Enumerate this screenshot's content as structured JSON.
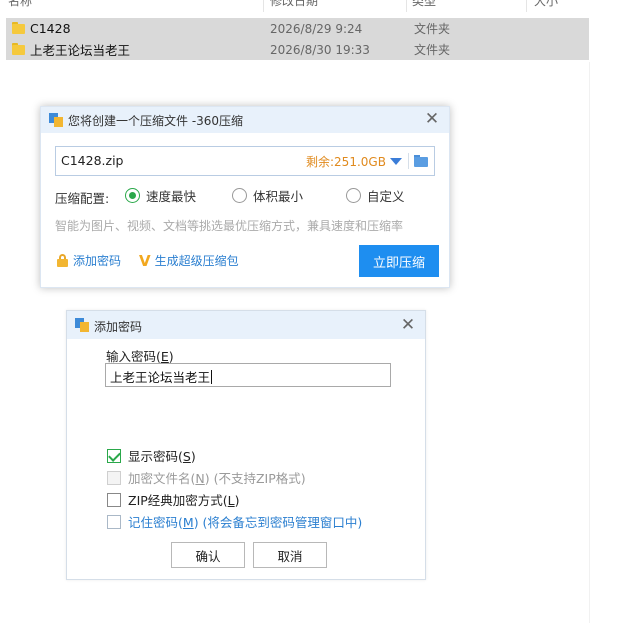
{
  "explorer": {
    "columns": [
      "名称",
      "修改日期",
      "类型",
      "大小"
    ],
    "rows": [
      {
        "name": "C1428",
        "date": "2026/8/29 9:24",
        "type": "文件夹"
      },
      {
        "name": "上老王论坛当老王",
        "date": "2026/8/30 19:33",
        "type": "文件夹"
      }
    ]
  },
  "compress_dialog": {
    "title": "您将创建一个压缩文件 -360压缩",
    "file_name": "C1428.zip",
    "free_space": "剩余:251.0GB",
    "config_label": "压缩配置:",
    "options": [
      "速度最快",
      "体积最小",
      "自定义"
    ],
    "selected_option": "速度最快",
    "hint": "智能为图片、视频、文档等挑选最优压缩方式，兼具速度和压缩率",
    "add_password": "添加密码",
    "super_pack": "生成超级压缩包",
    "compress_now": "立即压缩"
  },
  "password_dialog": {
    "title": "添加密码",
    "input_label": "输入密码(",
    "input_label_key": "E",
    "input_label_end": ")",
    "password_value": "上老王论坛当老王",
    "show_password": {
      "label": "显示密码(",
      "key": "S",
      "end": ")",
      "checked": true
    },
    "encrypt_names": {
      "label": "加密文件名(",
      "key": "N",
      "end": ") (不支持ZIP格式)",
      "checked": false,
      "disabled": true
    },
    "zip_classic": {
      "label": "ZIP经典加密方式(",
      "key": "L",
      "end": ")",
      "checked": false
    },
    "remember": {
      "label": "记住密码(",
      "key": "M",
      "end": ") (将会备忘到密码管理窗口中)",
      "checked": false
    },
    "ok": "确认",
    "cancel": "取消"
  },
  "colors": {
    "accent": "#1e8ef0",
    "check": "#2aa84a",
    "warning": "#e08a1e",
    "link": "#2b7fd0"
  }
}
